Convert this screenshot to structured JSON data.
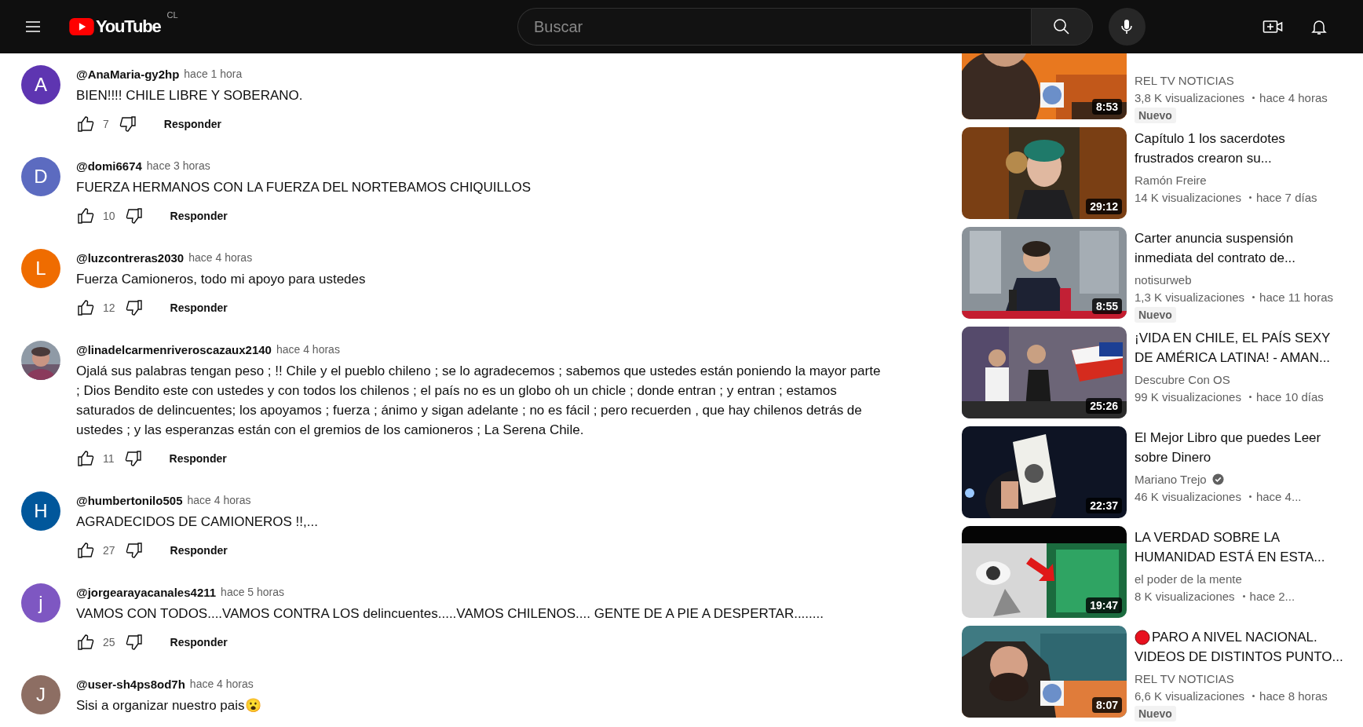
{
  "header": {
    "logo_text": "YouTube",
    "country": "CL",
    "search_placeholder": "Buscar"
  },
  "comments": [
    {
      "author": "@AnaMaria-gy2hp",
      "time": "hace 1 hora",
      "avatar": {
        "kind": "letter",
        "letter": "A",
        "color": "#5e35b1"
      },
      "text": "BIEN!!!! CHILE LIBRE Y SOBERANO.",
      "likes": "7",
      "reply": "Responder"
    },
    {
      "author": "@domi6674",
      "time": "hace 3 horas",
      "avatar": {
        "kind": "letter",
        "letter": "D",
        "color": "#5c6bc0"
      },
      "text": "FUERZA HERMANOS CON LA FUERZA DEL NORTEBAMOS  CHIQUILLOS",
      "likes": "10",
      "reply": "Responder"
    },
    {
      "author": "@luzcontreras2030",
      "time": "hace 4 horas",
      "avatar": {
        "kind": "letter",
        "letter": "L",
        "color": "#ef6c00"
      },
      "text": "Fuerza Camioneros, todo mi apoyo para ustedes",
      "likes": "12",
      "reply": "Responder"
    },
    {
      "author": "@linadelcarmenriveroscazaux2140",
      "time": "hace 4 horas",
      "text": "Ojalá  sus palabras tengan peso ; !!  Chile y el pueblo chileno ; se lo agradecemos ; sabemos que ustedes están poniendo la mayor parte ; Dios Bendito  este con ustedes y con todos los chilenos ; el país no es un globo oh un chicle ; donde entran ; y entran ; estamos saturados de delincuentes; los apoyamos ; fuerza ; ánimo  y sigan adelante ; no es fácil  ; pero recuerden , que hay chilenos detrás de ustedes ; y las esperanzas están con el gremios de los camioneros ; La Serena Chile.",
      "likes": "11",
      "reply": "Responder"
    },
    {
      "author": "@humbertonilo505",
      "time": "hace 4 horas",
      "avatar": {
        "kind": "letter",
        "letter": "H",
        "color": "#01579b"
      },
      "text": "AGRADECIDOS DE CAMIONEROS !!,...",
      "likes": "27",
      "reply": "Responder"
    },
    {
      "author": "@jorgearayacanales4211",
      "time": "hace 5 horas",
      "avatar": {
        "kind": "letter",
        "letter": "j",
        "color": "#7e57c2"
      },
      "text": "VAMOS CON TODOS....VAMOS CONTRA LOS delincuentes.....VAMOS CHILENOS.... GENTE DE A PIE A DESPERTAR........",
      "likes": "25",
      "reply": "Responder"
    },
    {
      "author": "@user-sh4ps8od7h",
      "time": "hace 4 horas",
      "avatar": {
        "kind": "letter",
        "letter": "J",
        "color": "#8d6e63"
      },
      "text": "Sisi a organizar nuestro pais😮"
    }
  ],
  "videos": [
    {
      "channel": "REL TV NOTICIAS",
      "verified": false,
      "live": false,
      "views": "3,8 K visualizaciones",
      "age": "hace 4 horas",
      "duration": "8:53",
      "badge": "Nuevo"
    },
    {
      "title_lines": [
        "Capítulo 1 los sacerdotes",
        "frustrados crearon su..."
      ],
      "channel": "Ramón Freire",
      "verified": false,
      "live": false,
      "views": "14 K visualizaciones",
      "age": "hace 7 días",
      "duration": "29:12"
    },
    {
      "title_lines": [
        "Carter anuncia suspensión",
        "inmediata del contrato de..."
      ],
      "channel": "notisurweb",
      "verified": false,
      "live": false,
      "views": "1,3 K visualizaciones",
      "age": "hace 11 horas",
      "duration": "8:55",
      "badge": "Nuevo"
    },
    {
      "title_lines": [
        "¡VIDA EN CHILE, EL PAÍS SEXY",
        "DE AMÉRICA LATINA! - AMAN..."
      ],
      "channel": "Descubre Con OS",
      "verified": false,
      "live": false,
      "views": "99 K visualizaciones",
      "age": "hace 10 días",
      "duration": "25:26"
    },
    {
      "title_lines": [
        "El Mejor Libro que puedes Leer",
        "sobre Dinero"
      ],
      "channel": "Mariano Trejo",
      "verified": true,
      "live": false,
      "views": "46 K visualizaciones",
      "age": "hace 4...",
      "duration": "22:37"
    },
    {
      "title_lines": [
        "LA VERDAD SOBRE LA",
        "HUMANIDAD ESTÁ EN ESTA..."
      ],
      "channel": "el poder de la mente",
      "verified": false,
      "live": false,
      "views": "8 K visualizaciones",
      "age": "hace 2...",
      "duration": "19:47"
    },
    {
      "title_lines": [
        "PARO A NIVEL NACIONAL.",
        "VIDEOS DE DISTINTOS PUNTO..."
      ],
      "channel": "REL TV NOTICIAS",
      "verified": false,
      "live": true,
      "views": "6,6 K visualizaciones",
      "age": "hace 8 horas",
      "duration": "8:07",
      "badge": "Nuevo"
    }
  ]
}
